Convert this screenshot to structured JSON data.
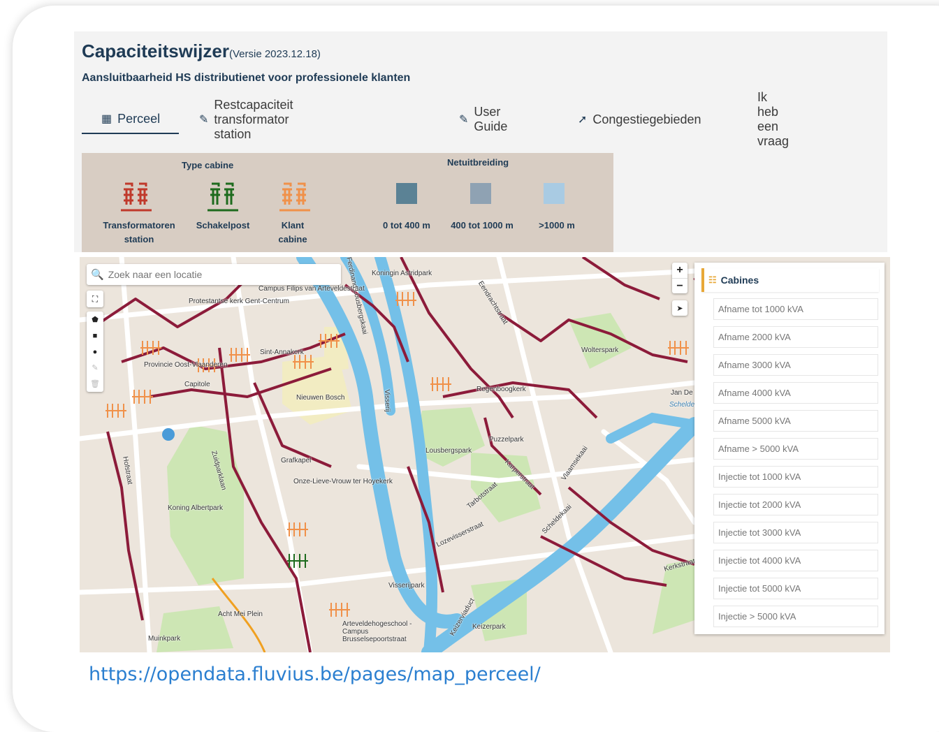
{
  "header": {
    "title": "Capaciteitswijzer",
    "version": "(Versie 2023.12.18)",
    "subtitle": "Aansluitbaarheid HS distributienet voor professionele klanten"
  },
  "tabs": [
    {
      "label": "Perceel",
      "icon": "map-icon",
      "active": true
    },
    {
      "label": "Restcapaciteit transformator station",
      "icon": "edit-icon"
    },
    {
      "label": "User Guide",
      "icon": "edit-icon"
    },
    {
      "label": "Congestiegebieden",
      "icon": "bolt-icon"
    },
    {
      "label": "Ik heb een vraag"
    }
  ],
  "legend": {
    "type_cabine_title": "Type cabine",
    "netuitbreiding_title": "Netuitbreiding",
    "cabine_types": [
      {
        "line1": "Transformatoren",
        "line2": "station",
        "color": "#c0392b"
      },
      {
        "line1": "Schakelpost",
        "line2": "",
        "color": "#1e6b1e"
      },
      {
        "line1": "Klant",
        "line2": "cabine",
        "color": "#f0914a"
      }
    ],
    "netuitbreiding": [
      {
        "label": "0 tot 400 m",
        "color": "#5b8295"
      },
      {
        "label": "400 tot 1000 m",
        "color": "#8fa2b3"
      },
      {
        "label": ">1000 m",
        "color": "#a9cbe3"
      }
    ]
  },
  "map": {
    "search_placeholder": "Zoek naar een locatie",
    "zoom_in": "+",
    "zoom_out": "−",
    "labels": [
      "Koningin Astridpark",
      "Protestantse kerk Gent-Centrum",
      "Campus Filips van Arteveldestraat",
      "Sint-Annakerk",
      "Provincie Oost-Vlaanderen",
      "Capitole",
      "Nieuwen Bosch",
      "Regenboogkerk",
      "Wolterspark",
      "Lousbergspark",
      "Puzzelpark",
      "Koning Albertpark",
      "Grafkapel",
      "Onze-Lieve-Vrouw ter Hoyekerk",
      "Acht Mei Plein",
      "Muinkpark",
      "Visserijpark",
      "Keizerpark",
      "Arteveldehogeschool - Campus Brusselsepoortstraat",
      "Eendrachtstraat",
      "Vlaamsekaai",
      "Scheldekaai",
      "Hofstraat",
      "Kerkstraat",
      "Ferdinand Lousbergskaai",
      "Visserij",
      "Keizerviaduct",
      "Zuidparklaan",
      "Tarbotstraat",
      "Karperstraat",
      "Lozevisserstraat",
      "Jan De",
      "Schelde"
    ]
  },
  "cabines": {
    "title": "Cabines",
    "items": [
      "Afname tot 1000 kVA",
      "Afname 2000 kVA",
      "Afname 3000 kVA",
      "Afname 4000 kVA",
      "Afname 5000 kVA",
      "Afname > 5000 kVA",
      "Injectie tot 1000 kVA",
      "Injectie tot 2000 kVA",
      "Injectie tot 3000 kVA",
      "Injectie tot 4000 kVA",
      "Injectie tot 5000 kVA",
      "Injectie > 5000 kVA"
    ]
  },
  "footer": {
    "url": "https://opendata.fluvius.be/pages/map_perceel/"
  }
}
